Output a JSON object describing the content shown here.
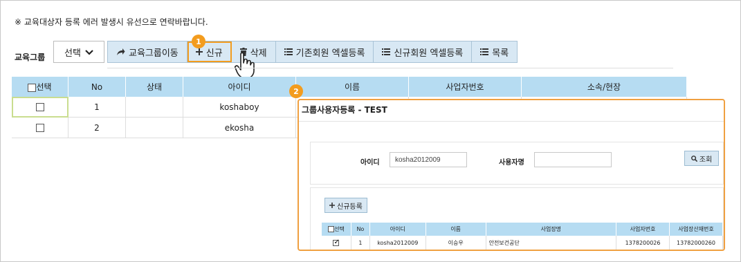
{
  "notice": "※ 교육대상자 등록 에러 발생시 유선으로 연락바랍니다.",
  "group_label": "교육그룹",
  "select": {
    "label": "선택"
  },
  "toolbar": {
    "move": "교육그룹이동",
    "new": "신규",
    "delete": "삭제",
    "excel_existing": "기존회원 엑셀등록",
    "excel_new": "신규회원 엑셀등록",
    "list": "목록"
  },
  "badges": {
    "one": "1",
    "two": "2"
  },
  "table": {
    "headers": [
      "선택",
      "No",
      "상태",
      "아이디",
      "이름",
      "사업자번호",
      "소속/현장"
    ],
    "rows": [
      {
        "no": "1",
        "status": "",
        "id": "koshaboy"
      },
      {
        "no": "2",
        "status": "",
        "id": "ekosha"
      }
    ]
  },
  "dialog": {
    "title": "그룹사용자등록 - TEST",
    "id_label": "아이디",
    "id_value": "kosha2012009",
    "user_label": "사용자명",
    "user_value": "",
    "search_btn": "조회",
    "new_btn": "신규등록",
    "headers": [
      "선택",
      "No",
      "아이디",
      "이름",
      "사업장명",
      "사업자번호",
      "사업장산재번호"
    ],
    "rows": [
      {
        "no": "1",
        "id": "kosha2012009",
        "name": "이승우",
        "workplace": "안전보건공단",
        "biz_no": "1378200026",
        "ins_no": "13782000260",
        "checked": true
      }
    ]
  },
  "colors": {
    "accent": "#f39c1e",
    "header_bg": "#b6dcf2",
    "button_bg": "#d8e8f4"
  }
}
